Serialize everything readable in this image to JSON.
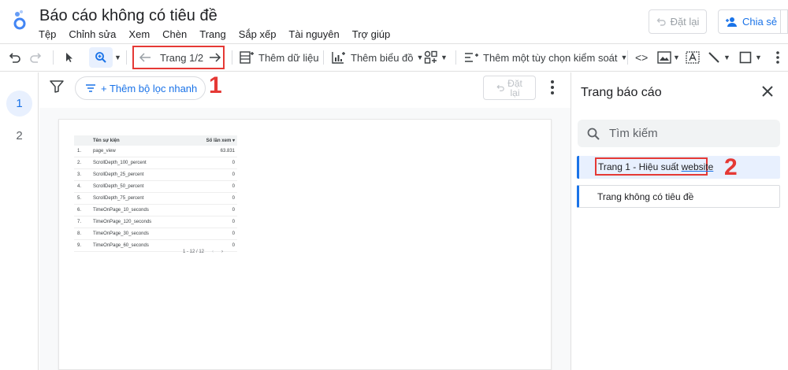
{
  "app": {
    "title": "Báo cáo không có tiêu đề",
    "menu": [
      "Tệp",
      "Chỉnh sửa",
      "Xem",
      "Chèn",
      "Trang",
      "Sắp xếp",
      "Tài nguyên",
      "Trợ giúp"
    ],
    "reset_label": "Đặt lại",
    "share_label": "Chia sẻ"
  },
  "toolbar": {
    "page_indicator": "Trang 1/2",
    "add_data": "Thêm dữ liệu",
    "add_chart": "Thêm biểu đồ",
    "add_control": "Thêm một tùy chọn kiểm soát"
  },
  "rail": {
    "pages": [
      "1",
      "2"
    ]
  },
  "filter_bar": {
    "quick_filter": "+ Thêm bộ lọc nhanh",
    "reset_line1": "Đặt",
    "reset_line2": "lại"
  },
  "annotations": {
    "marker1": "1",
    "marker2": "2"
  },
  "table": {
    "col_name": "Tên sự kiện",
    "col_value": "Số lần xem",
    "sort_icon": "▾",
    "rows": [
      {
        "n": "1.",
        "name": "page_view",
        "value": "63.831"
      },
      {
        "n": "2.",
        "name": "ScrollDepth_100_percent",
        "value": "0"
      },
      {
        "n": "3.",
        "name": "ScrollDepth_25_percent",
        "value": "0"
      },
      {
        "n": "4.",
        "name": "ScrollDepth_50_percent",
        "value": "0"
      },
      {
        "n": "5.",
        "name": "ScrollDepth_75_percent",
        "value": "0"
      },
      {
        "n": "6.",
        "name": "TimeOnPage_10_seconds",
        "value": "0"
      },
      {
        "n": "7.",
        "name": "TimeOnPage_120_seconds",
        "value": "0"
      },
      {
        "n": "8.",
        "name": "TimeOnPage_30_seconds",
        "value": "0"
      },
      {
        "n": "9.",
        "name": "TimeOnPage_60_seconds",
        "value": "0"
      }
    ],
    "pager": "1 - 12 / 12",
    "prev": "‹",
    "next": "›"
  },
  "panel": {
    "title": "Trang báo cáo",
    "search_placeholder": "Tìm kiếm",
    "page1_prefix": "Trang 1 - Hiệu suất ",
    "page1_link": "website",
    "page2": "Trang không có tiêu đề"
  },
  "colors": {
    "accent": "#1a73e8",
    "annotation": "#e53935",
    "selected_bg": "#e8f0fe"
  }
}
